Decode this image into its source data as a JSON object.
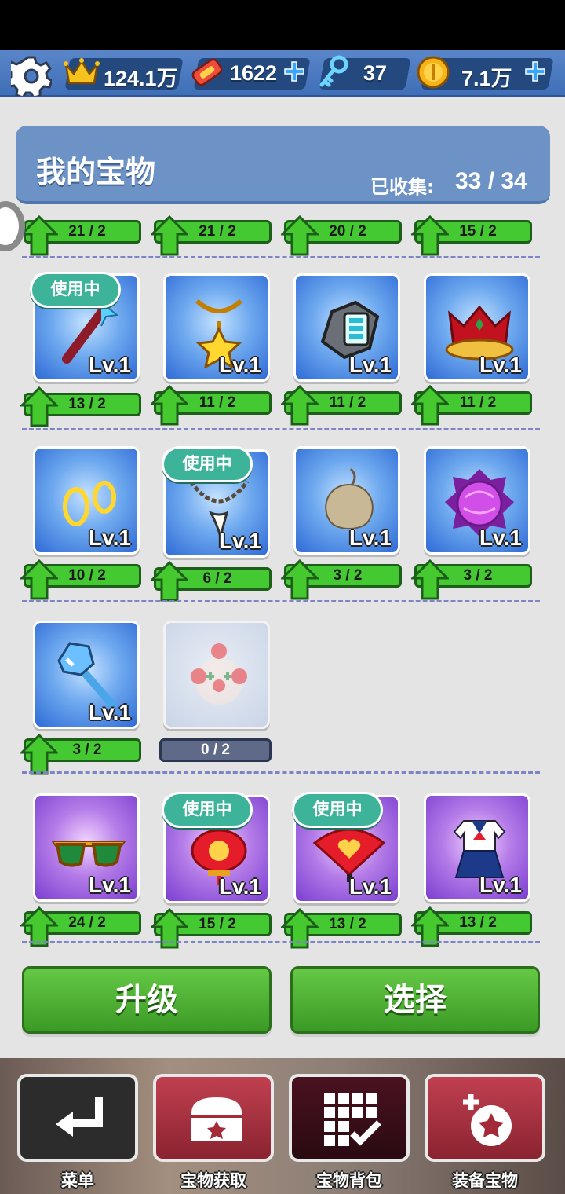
{
  "topbar": {
    "crown_value": "124.1万",
    "tickets_value": "1622",
    "keys_value": "37",
    "coins_value": "7.1万"
  },
  "header": {
    "title": "我的宝物",
    "collected_label": "已收集:",
    "collected_count": "33 / 34"
  },
  "labels": {
    "in_use": "使用中",
    "level": "Lv.1"
  },
  "partial_row_counts": [
    "21 / 2",
    "21 / 2",
    "20 / 2",
    "15 / 2"
  ],
  "rows": [
    [
      {
        "name": "magic-wand",
        "count": "13 / 2",
        "in_use": true,
        "color": "blue"
      },
      {
        "name": "star-necklace",
        "count": "11 / 2",
        "in_use": false,
        "color": "blue"
      },
      {
        "name": "smart-watch",
        "count": "11 / 2",
        "in_use": false,
        "color": "blue"
      },
      {
        "name": "gold-crown",
        "count": "11 / 2",
        "in_use": false,
        "color": "blue"
      }
    ],
    [
      {
        "name": "gold-rings",
        "count": "10 / 2",
        "in_use": false,
        "color": "blue"
      },
      {
        "name": "tooth-necklace",
        "count": "6 / 2",
        "in_use": true,
        "color": "blue"
      },
      {
        "name": "voodoo-doll",
        "count": "3 / 2",
        "in_use": false,
        "color": "blue"
      },
      {
        "name": "purple-crystal",
        "count": "3 / 2",
        "in_use": false,
        "color": "blue"
      }
    ],
    [
      {
        "name": "wrench",
        "count": "3 / 2",
        "in_use": false,
        "color": "blue"
      },
      {
        "name": "clown-mask",
        "count": "0 / 2",
        "in_use": false,
        "color": "dim",
        "locked": true
      }
    ],
    [
      {
        "name": "sunglasses",
        "count": "24 / 2",
        "in_use": false,
        "color": "purple"
      },
      {
        "name": "red-lantern",
        "count": "15 / 2",
        "in_use": true,
        "color": "purple"
      },
      {
        "name": "heart-fan",
        "count": "13 / 2",
        "in_use": true,
        "color": "purple"
      },
      {
        "name": "school-uniform",
        "count": "13 / 2",
        "in_use": false,
        "color": "purple"
      }
    ]
  ],
  "buttons": {
    "upgrade": "升级",
    "select": "选择"
  },
  "nav": {
    "menu": "菜单",
    "treasure_get": "宝物获取",
    "treasure_bag": "宝物背包",
    "equip_treasure": "装备宝物"
  },
  "colors": {
    "topbar": "#4a7cc4",
    "header": "#6d93c6",
    "bar_green": "#44c932",
    "bar_gray": "#5e6a87",
    "button_green": "#4caf34",
    "badge_teal": "#3db39a",
    "separator": "#7f84c7"
  },
  "icons": [
    "gear-icon",
    "crown-icon",
    "ticket-icon",
    "key-icon",
    "coin-icon",
    "plus-icon",
    "up-arrow-icon",
    "return-icon",
    "chest-icon",
    "grid-check-icon",
    "equip-icon"
  ]
}
